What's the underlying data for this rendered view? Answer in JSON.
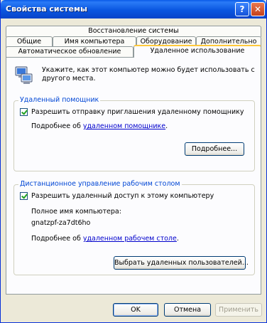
{
  "window": {
    "title": "Свойства системы",
    "help_label": "?",
    "close_label": "✕"
  },
  "tabs": {
    "row1": [
      "Восстановление системы"
    ],
    "row2": [
      "Общие",
      "Имя компьютера",
      "Оборудование",
      "Дополнительно"
    ],
    "row3": [
      "Автоматическое обновление",
      "Удаленное использование"
    ],
    "active": "Удаленное использование"
  },
  "intro": {
    "text": "Укажите, как этот компьютер можно будет использовать с другого места."
  },
  "remote_assistance": {
    "title": "Удаленный помощник",
    "checkbox_label": "Разрешить отправку приглашения удаленному помощнику",
    "checked": true,
    "more_text": "Подробнее об ",
    "more_link": "удаленном помощнике",
    "more_suffix": ".",
    "button_label": "Подробнее..."
  },
  "remote_desktop": {
    "title": "Дистанционное управление рабочим столом",
    "checkbox_label": "Разрешить удаленный доступ к этому компьютеру",
    "checked": true,
    "full_name_label": "Полное имя компьютера:",
    "computer_name": "gnatzpf-za7dt6ho",
    "more_text": "Подробнее об ",
    "more_link": "удаленном рабочем столе",
    "more_suffix": ".",
    "button_label": "Выбрать удаленных пользователей..."
  },
  "footer": {
    "ok_label": "OK",
    "cancel_label": "Отмена",
    "apply_label": "Применить"
  }
}
